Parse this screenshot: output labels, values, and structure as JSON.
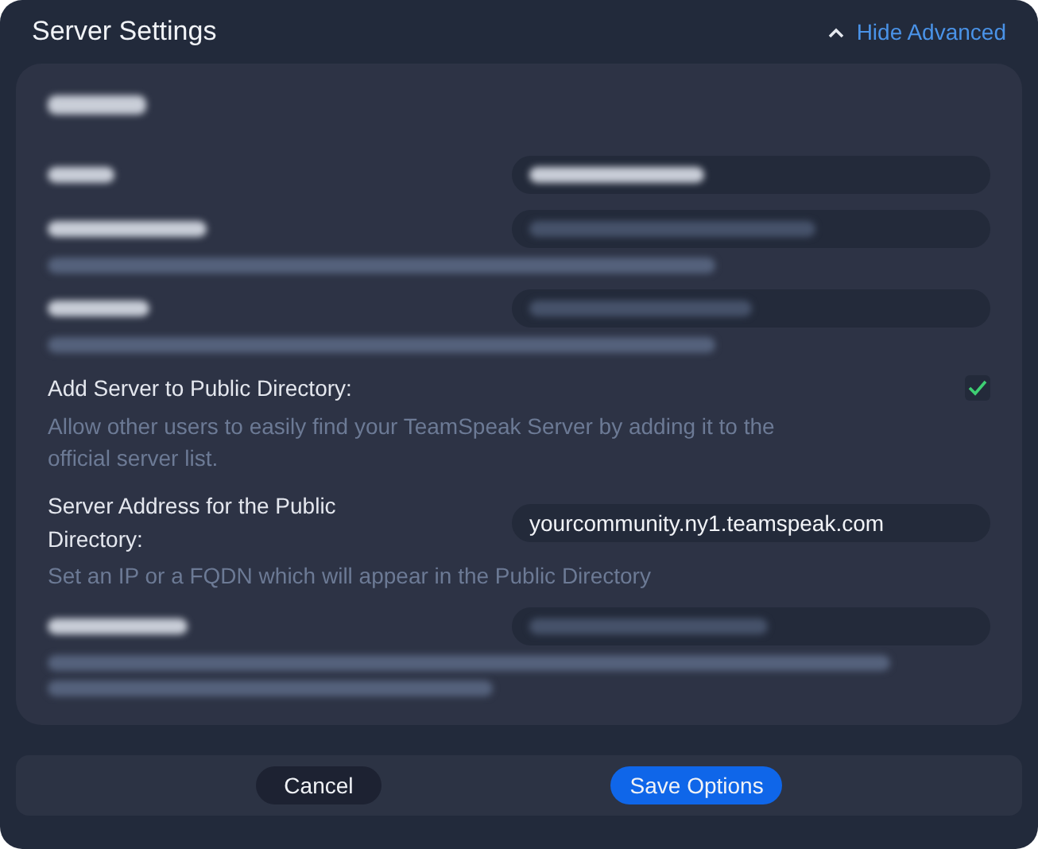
{
  "window": {
    "title": "Server Settings"
  },
  "advanced_toggle": {
    "label": "Hide Advanced",
    "expanded": true
  },
  "section": {
    "blurred": true
  },
  "settings": [
    {
      "kind": "text",
      "blurred": true,
      "has_description": false
    },
    {
      "kind": "text",
      "blurred": true,
      "has_description": true,
      "description_wraps": false
    },
    {
      "kind": "text",
      "blurred": true,
      "has_description": true,
      "description_wraps": false
    },
    {
      "kind": "checkbox",
      "blurred": false,
      "label": "Add Server to Public Directory:",
      "checked": true,
      "description": "Allow other users to easily find your TeamSpeak Server by adding it to the official server list."
    },
    {
      "kind": "text",
      "blurred": false,
      "label": "Server Address for the Public Directory:",
      "value": "yourcommunity.ny1.teamspeak.com",
      "description": "Set an IP or a FQDN which will appear in the Public Directory"
    },
    {
      "kind": "text",
      "blurred": true,
      "has_description": true,
      "description_wraps": true
    }
  ],
  "buttons": [
    {
      "kind": "secondary",
      "label": "Cancel"
    },
    {
      "kind": "primary",
      "label": "Save Options"
    }
  ]
}
